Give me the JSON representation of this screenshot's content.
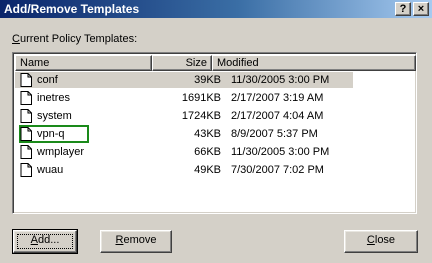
{
  "window": {
    "title": "Add/Remove Templates",
    "help_label": "?",
    "close_label": "×"
  },
  "list_label": {
    "accel": "C",
    "rest": "urrent Policy Templates:"
  },
  "columns": {
    "name": "Name",
    "size": "Size",
    "modified": "Modified"
  },
  "rows": [
    {
      "name": "conf",
      "size": "39KB",
      "modified": "11/30/2005 3:00 PM"
    },
    {
      "name": "inetres",
      "size": "1691KB",
      "modified": "2/17/2007 3:19 AM"
    },
    {
      "name": "system",
      "size": "1724KB",
      "modified": "2/17/2007 4:04 AM"
    },
    {
      "name": "vpn-q",
      "size": "43KB",
      "modified": "8/9/2007 5:37 PM"
    },
    {
      "name": "wmplayer",
      "size": "66KB",
      "modified": "11/30/2005 3:00 PM"
    },
    {
      "name": "wuau",
      "size": "49KB",
      "modified": "7/30/2007 7:02 PM"
    }
  ],
  "buttons": {
    "add_accel": "A",
    "add_rest": "dd...",
    "remove_accel": "R",
    "remove_rest": "emove",
    "close_accel": "C",
    "close_rest": "lose"
  }
}
